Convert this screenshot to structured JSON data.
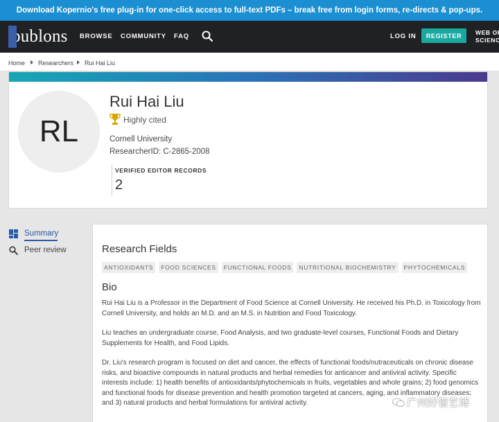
{
  "banner": {
    "text": "Download Kopernio's free plug-in for one-click access to full-text PDFs – break free from login forms, re-directs & pop-ups."
  },
  "nav": {
    "logo": "publons",
    "browse": "BROWSE",
    "community": "COMMUNITY",
    "faq": "FAQ",
    "login": "LOG IN",
    "register": "REGISTER",
    "wos_line1": "WEB OF",
    "wos_line2": "SCIENCE"
  },
  "breadcrumb": {
    "items": [
      "Home",
      "Researchers",
      "Rui Hai Liu"
    ]
  },
  "profile": {
    "initials": "RL",
    "name": "Rui Hai Liu",
    "highly_cited": "Highly cited",
    "institution": "Cornell University",
    "researcher_id_label": "ResearcherID:",
    "researcher_id": "C-2865-2008",
    "verified_label": "VERIFIED EDITOR RECORDS",
    "verified_count": "2"
  },
  "sidebar": {
    "items": [
      {
        "label": "Summary"
      },
      {
        "label": "Peer review"
      }
    ]
  },
  "main": {
    "fields_title": "Research Fields",
    "tags": [
      "ANTIOXIDANTS",
      "FOOD SCIENCES",
      "FUNCTIONAL FOODS",
      "NUTRITIONAL BIOCHEMISTRY",
      "PHYTOCHEMICALS"
    ],
    "bio_title": "Bio",
    "bio_p1": "Rui Hai Liu is a Professor in the Department of Food Science at Cornell University. He received his Ph.D. in Toxicology from Cornell University, and holds an M.D. and an M.S. in Nutrition and Food Toxicology.",
    "bio_p2": "Liu teaches an undergraduate course, Food Analysis, and two graduate-level courses, Functional Foods and Dietary Supplements for Health, and Food Lipids.",
    "bio_p3": "Dr. Liu's research program is focused on diet and cancer, the effects of functional foods/nutraceuticals on chronic disease risks, and bioactive compounds in natural products and herbal remedies for anticancer and antiviral activity. Specific interests include: 1) health benefits of antioxidants/phytochemicals in fruits, vegetables and whole grains; 2) food genomics and functional foods for disease prevention and health promotion targeted at cancers, aging, and inflammatory diseases; and 3) natural products and herbal formulations for antiviral activity."
  },
  "watermark": {
    "text": "广州好普艺博"
  },
  "colors": {
    "banner": "#1b8fd1",
    "nav": "#202124",
    "register": "#1aa9a0",
    "trophy": "#d9a400"
  }
}
